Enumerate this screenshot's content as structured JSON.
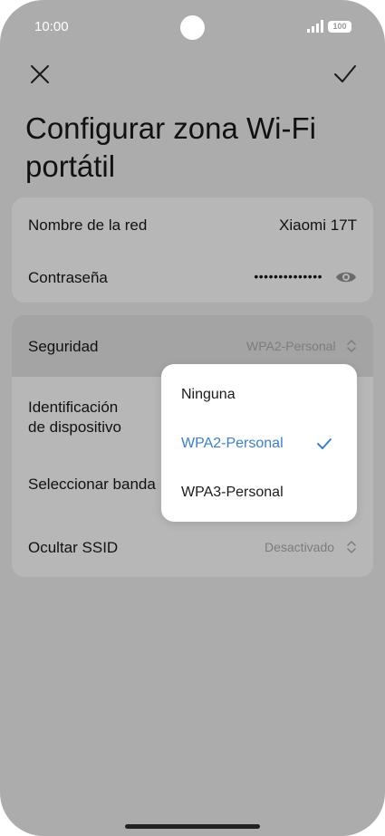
{
  "status_bar": {
    "time": "10:00",
    "battery": "100"
  },
  "header": {
    "close_icon": "close-icon",
    "confirm_icon": "check-icon",
    "title": "Configurar zona Wi-Fi portátil"
  },
  "network_card": {
    "name_label": "Nombre de la red",
    "name_value": "Xiaomi 17T",
    "password_label": "Contraseña",
    "password_value": "••••••••••••••",
    "eye_icon": "eye-icon"
  },
  "settings_card": {
    "security_label": "Seguridad",
    "security_value": "WPA2-Personal",
    "device_id_label_line1": "Identificación",
    "device_id_label_line2": "de dispositivo",
    "band_label": "Seleccionar banda",
    "hide_ssid_label": "Ocultar SSID",
    "hide_ssid_value": "Desactivado"
  },
  "security_menu": {
    "options": [
      "Ninguna",
      "WPA2-Personal",
      "WPA3-Personal"
    ],
    "selected": "WPA2-Personal",
    "accent_color": "#3a7ed4"
  }
}
